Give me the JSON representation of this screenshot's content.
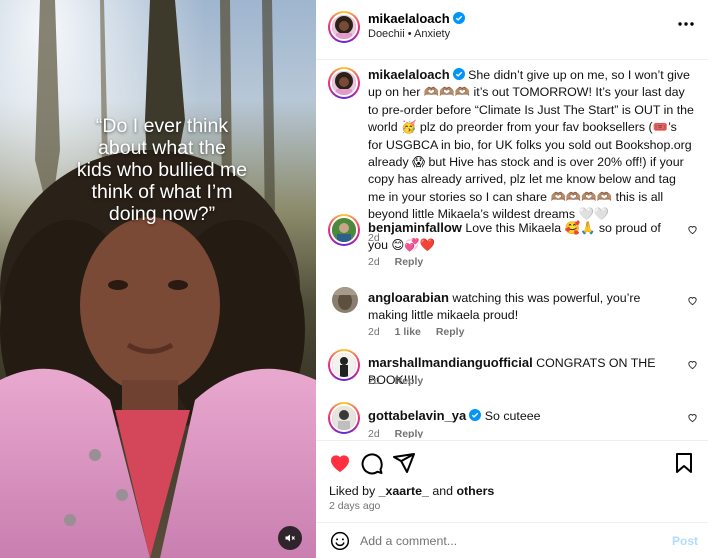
{
  "media": {
    "overlay_text": "“Do I ever think\nabout what the\nkids who bullied me\nthink of what I’m\ndoing now?”",
    "mute_icon": "speaker-muted-icon"
  },
  "header": {
    "username": "mikaelaloach",
    "audio": "Doechii • Anxiety",
    "more_icon": "more-horizontal-icon"
  },
  "caption": {
    "username": "mikaelaloach",
    "text": "She didn’t give up on me, so I won’t give up on her 🫶🏽🫶🏽🫶🏽 it’s out TOMORROW! It’s your last day to pre-order before “Climate Is Just The Start” is OUT in the world 🥳 plz do preorder from your fav booksellers (🎟️’s for USGBCA in bio, for UK folks you sold out Bookshop.org already 😱 but Hive has stock and is over 20% off!) if your copy has already arrived, plz let me know below and tag me in your stories so I can share 🫶🏽🫶🏽🫶🏽🫶🏽 this is all beyond little Mikaela’s wildest dreams 🤍🤍",
    "time": "2d"
  },
  "comments": [
    {
      "username": "benjaminfallow",
      "text": "Love this Mikaela 🥰🙏 so proud of you 😊💞❤️",
      "time": "2d",
      "likes": "",
      "reply": "Reply"
    },
    {
      "username": "angloarabian",
      "text": "watching this was powerful, you’re making little mikaela proud!",
      "time": "2d",
      "likes": "1 like",
      "reply": "Reply"
    },
    {
      "username": "marshallmandianguofficial",
      "text": "CONGRATS ON THE BOOK!!!!",
      "time": "2d",
      "likes": "",
      "reply": "Reply"
    },
    {
      "username": "gottabelavin_ya",
      "text": "So cuteee",
      "time": "2d",
      "likes": "",
      "reply": "Reply"
    }
  ],
  "actions": {
    "like_icon": "heart-filled-icon",
    "comment_icon": "comment-icon",
    "share_icon": "share-icon",
    "save_icon": "bookmark-icon",
    "like_color": "#ff3040"
  },
  "likes": {
    "prefix": "Liked by ",
    "user": "_xaarte_",
    "middle": " and ",
    "others": "others"
  },
  "date": "2 days ago",
  "add_comment": {
    "placeholder": "Add a comment...",
    "post_label": "Post",
    "emoji_icon": "emoji-icon"
  },
  "colors": {
    "verified": "#0095f6",
    "muted_text": "#737373",
    "post_disabled": "#b3dbff"
  }
}
